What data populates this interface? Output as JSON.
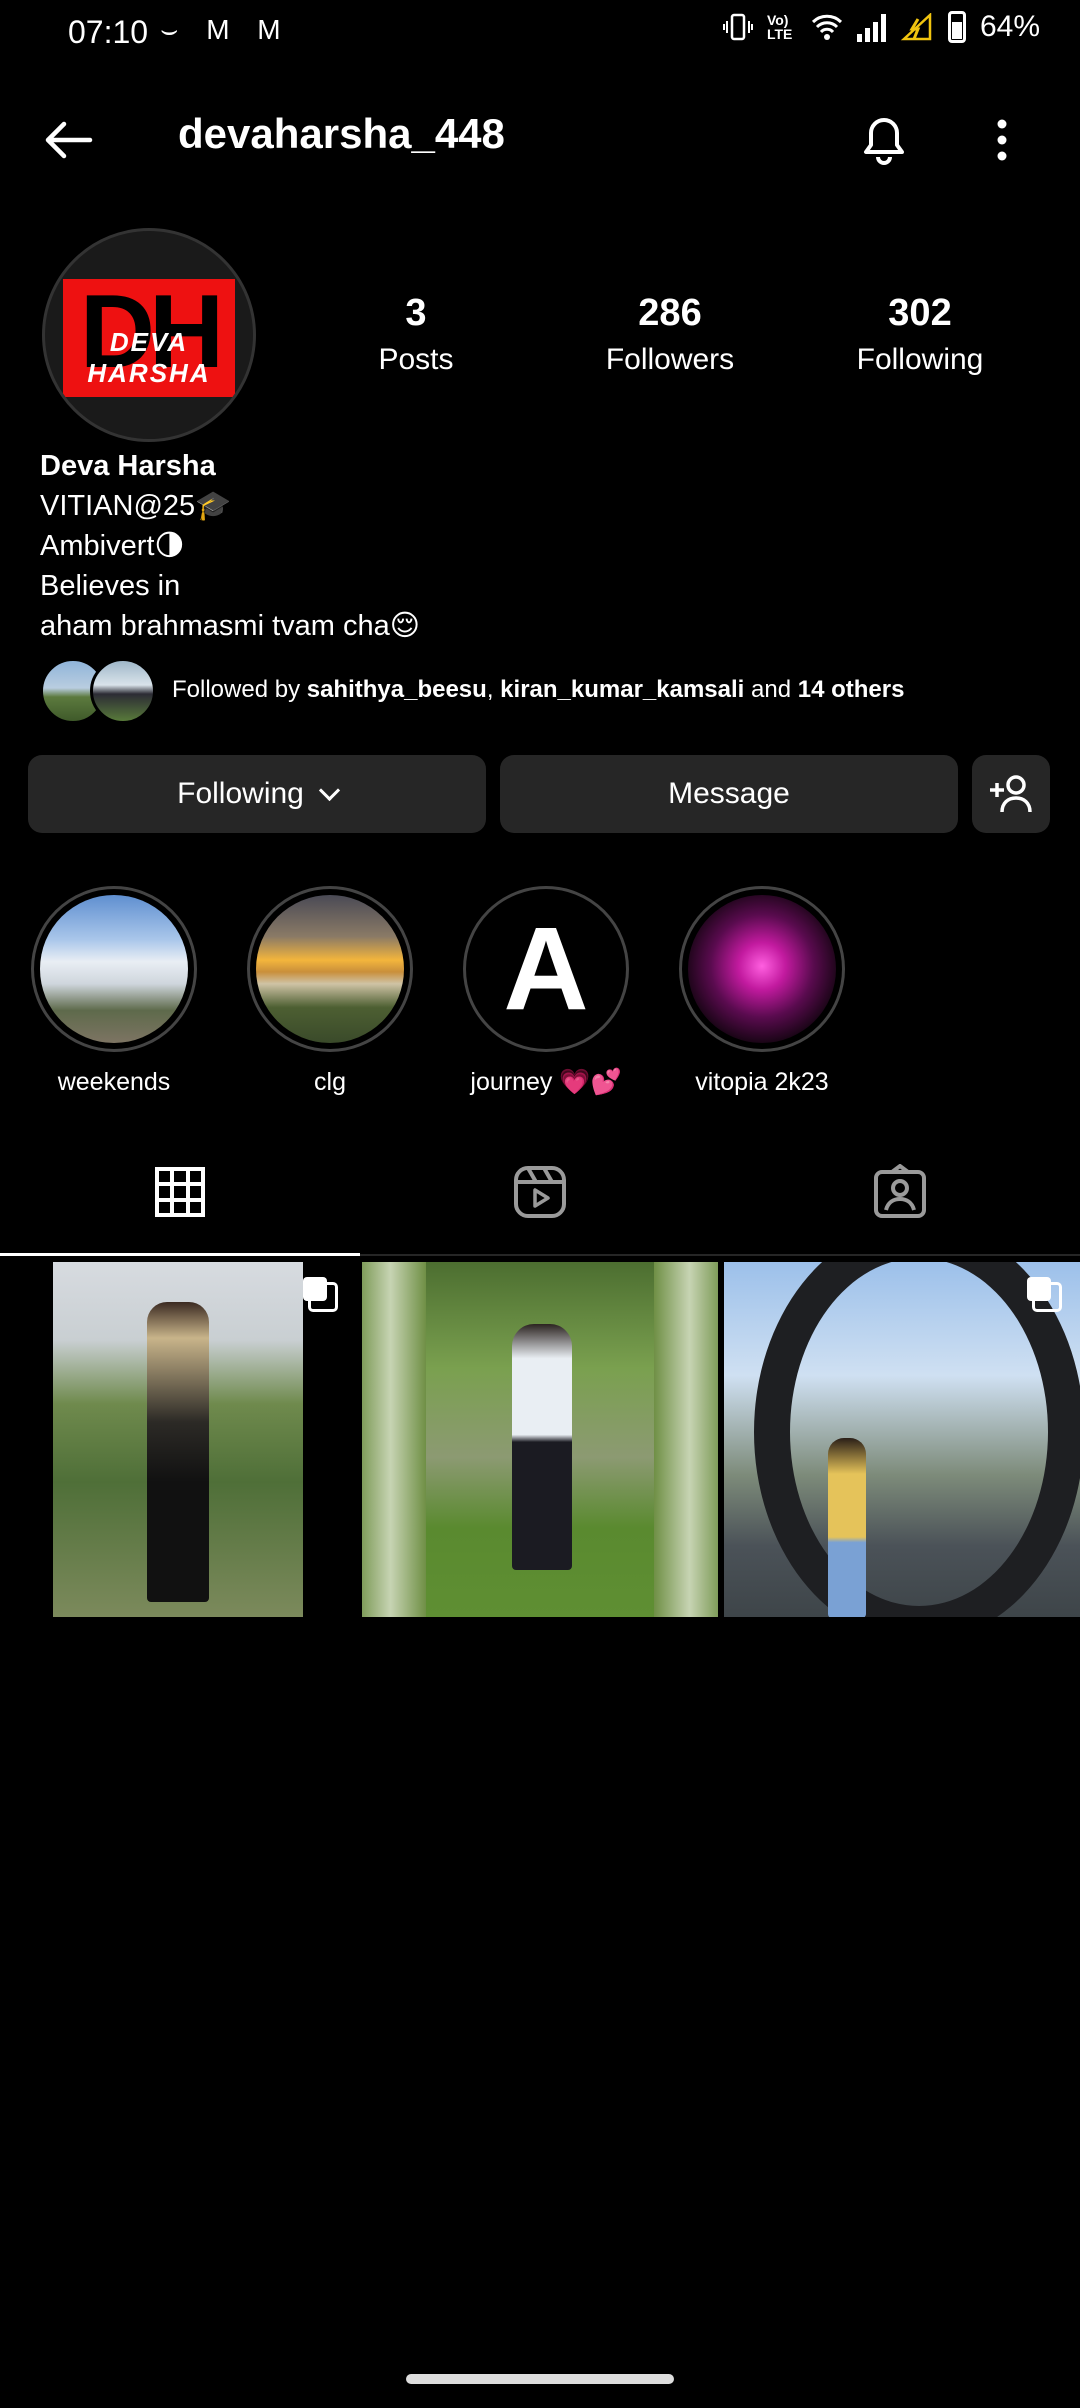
{
  "status_bar": {
    "time": "07:10",
    "notification_icons": "⌣ M M",
    "network": "Vo) LTE",
    "battery": "64%"
  },
  "header": {
    "username": "devaharsha_448",
    "back_icon": "back-arrow-icon",
    "bell_icon": "bell-icon",
    "menu_icon": "more-vertical-icon"
  },
  "profile": {
    "avatar_text_big": "DH",
    "avatar_text_small": "DEVA HARSHA",
    "stats": [
      {
        "value": "3",
        "label": "Posts"
      },
      {
        "value": "286",
        "label": "Followers"
      },
      {
        "value": "302",
        "label": "Following"
      }
    ],
    "name": "Deva Harsha",
    "bio_lines": [
      "VITIAN@25🎓",
      "Ambivert🌗",
      "Believes in",
      "aham brahmasmi tvam cha😌"
    ],
    "followed_by": {
      "prefix": "Followed by ",
      "user1": "sahithya_beesu",
      "sep": ", ",
      "user2": "kiran_kumar_kamsali",
      "and": " and ",
      "others": "14 others"
    }
  },
  "actions": {
    "following_label": "Following",
    "message_label": "Message",
    "add_person_icon": "add-person-icon"
  },
  "highlights": [
    {
      "label": "weekends"
    },
    {
      "label": "clg"
    },
    {
      "label": "journey 💗💕",
      "glyph": "A"
    },
    {
      "label": "vitopia 2k23"
    }
  ],
  "tabs": [
    "grid-icon",
    "reels-icon",
    "tagged-icon"
  ],
  "accent": {
    "background": "#000000",
    "button": "#262626",
    "avatar_red": "#e11111"
  }
}
